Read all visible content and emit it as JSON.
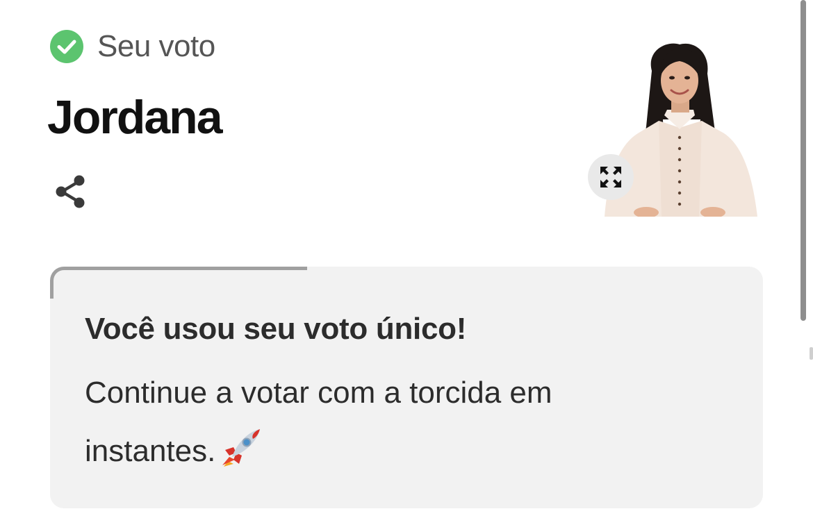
{
  "header": {
    "status_label": "Seu voto",
    "status_icon": "check-circle-icon",
    "status_color": "#5cc46f",
    "candidate_name": "Jordana",
    "share_icon": "share-icon"
  },
  "photo": {
    "alt": "Jordana",
    "expand_icon": "expand-icon"
  },
  "card": {
    "title": "Você usou seu voto único!",
    "body": "Continue a votar com a torcida em instantes.",
    "emoji_icon": "rocket-icon",
    "background": "#f2f2f2"
  }
}
